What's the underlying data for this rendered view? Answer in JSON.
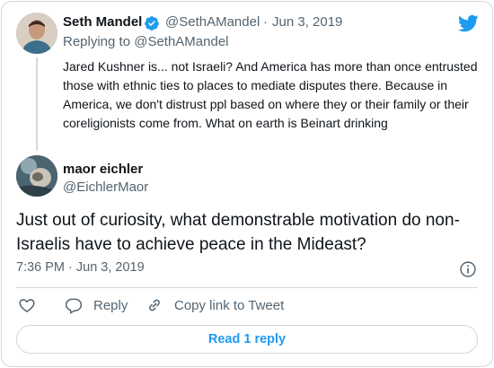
{
  "tweet1": {
    "name": "Seth Mandel",
    "handle": "@SethAMandel",
    "separator": "·",
    "date": "Jun 3, 2019",
    "replying_prefix": "Replying to",
    "replying_to": "@SethAMandel",
    "text": "Jared Kushner is... not Israeli? And America has more than once entrusted those with ethnic ties to places to mediate disputes there. Because in America, we don't distrust ppl based on where they or their family or their coreligionists come from. What on earth is Beinart drinking"
  },
  "tweet2": {
    "name": "maor eichler",
    "handle": "@EichlerMaor",
    "text": "Just out of curiosity, what demonstrable motivation do non-Israelis have to achieve peace in the Mideast?",
    "timestamp": "7:36 PM · Jun 3, 2019"
  },
  "actions": {
    "like_icon": "heart-icon",
    "reply_label": "Reply",
    "copy_link_label": "Copy link to Tweet"
  },
  "read_replies_label": "Read 1 reply",
  "colors": {
    "accent": "#1d9bf0",
    "secondary_text": "#536471",
    "border": "#cfd9de"
  }
}
